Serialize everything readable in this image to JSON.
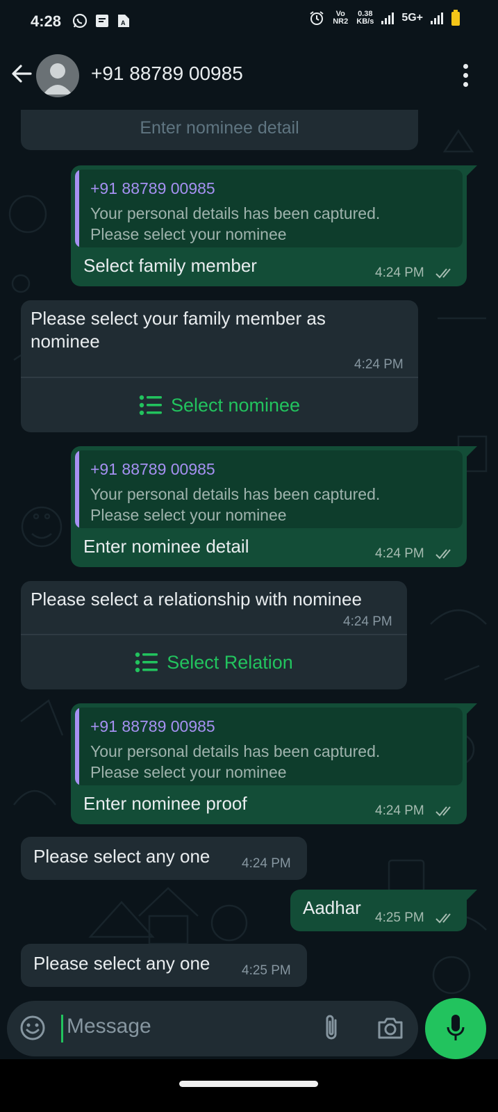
{
  "status_bar": {
    "time": "4:28",
    "net_type": "Vo NR2",
    "speed": "0.38",
    "speed_unit": "KB/s",
    "signal_label": "5G+",
    "icons": [
      "whatsapp-icon",
      "notes-icon",
      "sim-icon",
      "alarm-icon",
      "signal-icon",
      "battery-icon"
    ]
  },
  "header": {
    "contact": "+91 88789 00985"
  },
  "colors": {
    "incoming_bubble": "#202c33",
    "outgoing_bubble": "#134d37",
    "quote_name": "#a691f2",
    "accent_green": "#22c35e",
    "background": "#0b141a"
  },
  "messages": {
    "top_partial": "Enter nominee detail",
    "m1": {
      "quote_name": "+91 88789 00985",
      "quote_line1": "Your personal details has been captured.",
      "quote_line2": "Please select your nominee",
      "text": "Select family member",
      "time": "4:24 PM"
    },
    "m2": {
      "text_line1": "Please select your family member as",
      "text_line2": "nominee",
      "time": "4:24 PM",
      "action": "Select nominee"
    },
    "m3": {
      "quote_name": "+91 88789 00985",
      "quote_line1": "Your personal details has been captured.",
      "quote_line2": "Please select your nominee",
      "text": "Enter nominee detail",
      "time": "4:24 PM"
    },
    "m4": {
      "text": "Please select a relationship with nominee",
      "time": "4:24 PM",
      "action": "Select Relation"
    },
    "m5": {
      "quote_name": "+91 88789 00985",
      "quote_line1": "Your personal details has been captured.",
      "quote_line2": "Please select your nominee",
      "text": "Enter nominee proof",
      "time": "4:24 PM"
    },
    "m6": {
      "text": "Please select any one",
      "time": "4:24 PM"
    },
    "m7": {
      "text": "Aadhar",
      "time": "4:25 PM"
    },
    "m8": {
      "text": "Please select any one",
      "time": "4:25 PM"
    }
  },
  "input": {
    "placeholder": "Message"
  }
}
